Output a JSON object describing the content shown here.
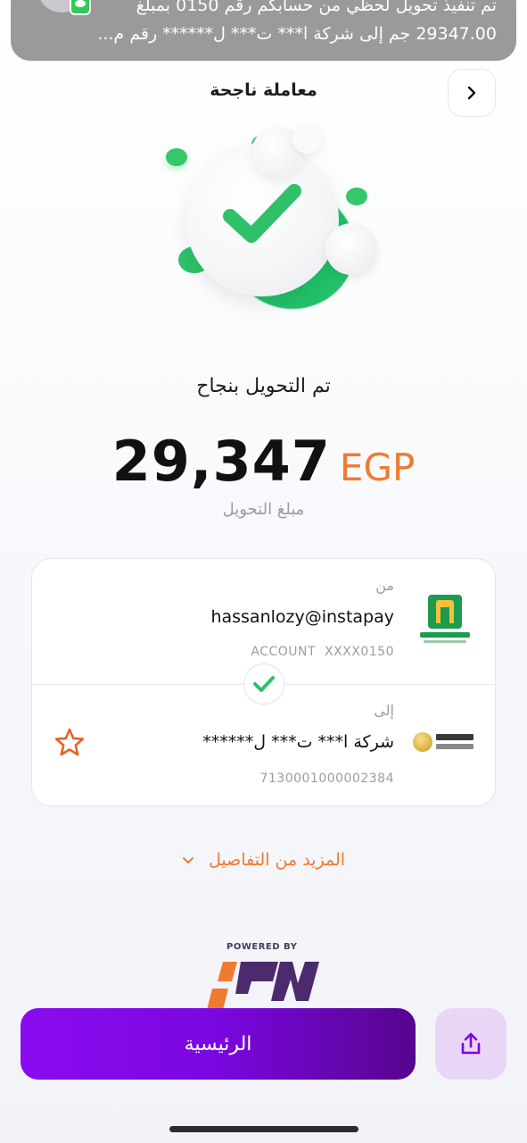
{
  "notification": {
    "line1": "تم تنفيذ تحويل لحظي من حسابكم رقم 0150 بمبلغ",
    "line2": "29347.00 جم إلى شركة ا*** ت*** ل****** رقم م...",
    "icons": [
      "contact-avatar-icon",
      "messages-app-icon"
    ]
  },
  "header": {
    "title": "معاملة ناجحة",
    "back_icon": "chevron-right-icon"
  },
  "status": {
    "title": "تم التحويل بنجاح",
    "amount": "29,347",
    "currency": "EGP",
    "amount_label": "مبلغ التحويل",
    "colors": {
      "success": "#2fc16a",
      "accent": "#f07a32"
    }
  },
  "from": {
    "label": "من",
    "address": "hassanlozy@instapay",
    "account_prefix": "ACCOUNT",
    "account": "XXXX0150",
    "bank_icon": "nbe-bank-logo"
  },
  "to": {
    "label": "إلى",
    "name": "شركة ا*** ت*** ل******",
    "account": "7130001000002384",
    "bank_icon": "banque-misr-logo",
    "favorite_icon": "star-icon"
  },
  "more_details": {
    "label": "المزيد من التفاصيل",
    "icon": "chevron-down-icon"
  },
  "powered_by": {
    "label": "POWERED BY",
    "logo": "ipn-logo"
  },
  "actions": {
    "home_label": "الرئيسية",
    "share_icon": "share-icon",
    "primary_color": "#7a07e0"
  }
}
